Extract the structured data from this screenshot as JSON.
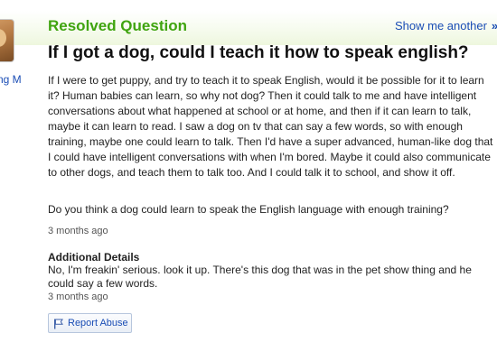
{
  "asker": {
    "name_fragment": "ng M"
  },
  "question": {
    "status": "Resolved Question",
    "show_another_label": "Show me another",
    "show_another_arrow": "»",
    "title": "If I got a dog, could I teach it how to speak english?",
    "body": "If I were to get puppy, and try to teach it to speak English, would it be possible for it to learn it? Human babies can learn, so why not dog? Then it could talk to me and have intelligent conversations about what happened at school or at home, and then if it can learn to talk, maybe it can learn to read. I saw a dog on tv that can say a few words, so with enough training, maybe one could learn to talk. Then I'd have a super advanced, human-like dog that I could have intelligent conversations with when I'm bored. Maybe it could also communicate to other dogs, and teach them to talk too. And I could talk it to school, and show it off.",
    "followup": "Do you think a dog could learn to speak the English language with enough training?",
    "timestamp": "3 months ago"
  },
  "additional_details": {
    "heading": "Additional Details",
    "text": "No, I'm freakin' serious. look it up. There's this dog that was in the pet show thing and he could say a few words.",
    "timestamp": "3 months ago"
  },
  "actions": {
    "report_abuse_label": "Report Abuse",
    "report_abuse_icon": "flag-icon"
  },
  "colors": {
    "status_green": "#3fa40f",
    "link_blue": "#1a4db5",
    "header_gradient_end": "#eef7de"
  }
}
